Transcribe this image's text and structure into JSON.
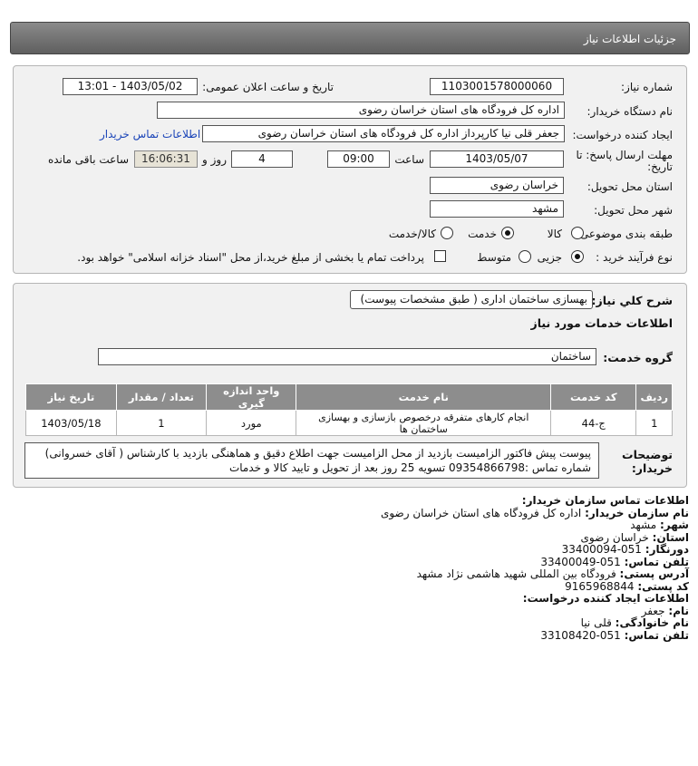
{
  "header": {
    "title": "جزئیات اطلاعات نیاز"
  },
  "form": {
    "need_number_label": "شماره نیاز:",
    "need_number": "1103001578000060",
    "announce_label": "تاریخ و ساعت اعلان عمومی:",
    "announce_value": "1403/05/02 - 13:01",
    "buyer_org_label": "نام دستگاه خریدار:",
    "buyer_org": "اداره کل فرودگاه های استان خراسان رضوی",
    "creator_label": "ایجاد کننده درخواست:",
    "creator": "جعفر قلی نیا کارپرداز اداره کل فرودگاه های استان خراسان رضوی",
    "contact_link": "اطلاعات تماس خریدار",
    "deadline_label_1": "مهلت ارسال پاسخ: تا",
    "deadline_label_2": "تاریخ:",
    "deadline_date": "1403/05/07",
    "time_label": "ساعت",
    "deadline_time": "09:00",
    "days_value": "4",
    "days_label": "روز و",
    "remaining_time": "16:06:31",
    "remaining_label": "ساعت باقی مانده",
    "province_label": "استان محل تحویل:",
    "province": "خراسان رضوی",
    "city_label": "شهر محل تحویل:",
    "city": "مشهد",
    "category_label": "طبقه بندی موضوعی:",
    "category_options": [
      "کالا",
      "خدمت",
      "کالا/خدمت"
    ],
    "category_selected": "خدمت",
    "process_label": "نوع فرآیند خرید :",
    "process_options": [
      "جزیی",
      "متوسط"
    ],
    "process_selected": "جزیی",
    "payment_note": "پرداخت تمام یا بخشی از مبلغ خرید،از محل \"اسناد خزانه اسلامی\" خواهد بود."
  },
  "details": {
    "summary_label": "شرح کلي نياز:",
    "summary": "بهسازی ساختمان اداری ( طبق مشخصات پیوست)",
    "services_title": "اطلاعات خدمات مورد نیاز",
    "service_group_label": "گروه خدمت:",
    "service_group": "ساختمان",
    "table": {
      "headers": [
        "ردیف",
        "کد خدمت",
        "نام خدمت",
        "واحد اندازه گیری",
        "تعداد / مقدار",
        "تاریخ نیاز"
      ],
      "rows": [
        [
          "1",
          "ج-44",
          "انجام کارهای متفرقه درخصوص بازسازی و بهسازی ساختمان ها",
          "مورد",
          "1",
          "1403/05/18"
        ]
      ]
    },
    "notes_label_1": "توضیحات",
    "notes_label_2": "خریدار:",
    "notes_line1": "پیوست پیش فاکتور الزامیست بازدید از محل الزامیست جهت اطلاع دقیق و هماهنگی بازدید با کارشناس ( آقای خسروانی)",
    "notes_line2": "شماره تماس :09354866798 تسویه 25 روز بعد از تحویل و تایید کالا و خدمات"
  },
  "contact": {
    "org_heading": "اطلاعات تماس سازمان خریدار:",
    "org_name_label": "نام سازمان خریدار:",
    "org_name": "اداره کل فرودگاه های استان خراسان رضوی",
    "city_label": "شهر:",
    "city": "مشهد",
    "province_label": "استان:",
    "province": "خراسان رضوی",
    "fax_label": "دورنگار:",
    "fax": "051-33400094",
    "phone_label": "تلفن تماس:",
    "phone": "051-33400049",
    "address_label": "آدرس پستی:",
    "address": "فرودگاه بین المللی شهید هاشمی نژاد مشهد",
    "postal_label": "کد پستی:",
    "postal": "9165968844",
    "creator_heading": "اطلاعات ایجاد کننده درخواست:",
    "first_name_label": "نام:",
    "first_name": "جعفر",
    "last_name_label": "نام خانوادگی:",
    "last_name": "قلی نیا",
    "creator_phone_label": "تلفن تماس:",
    "creator_phone": "051-33108420"
  }
}
